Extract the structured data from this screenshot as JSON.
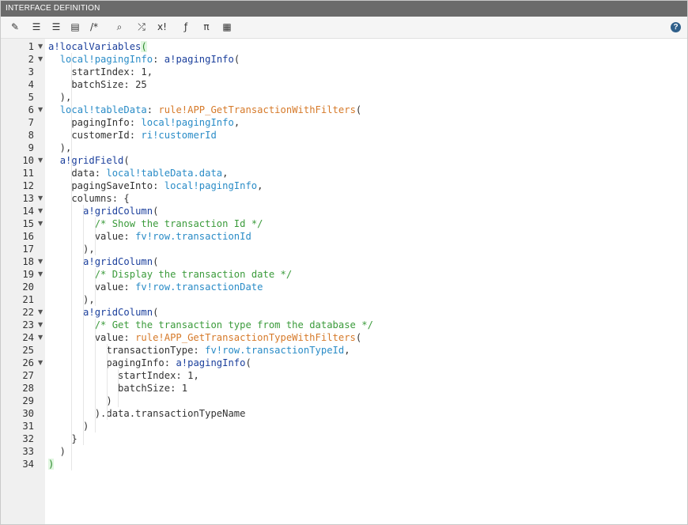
{
  "panel": {
    "title": "INTERFACE DEFINITION"
  },
  "toolbar": {
    "buttons": [
      {
        "name": "edit-icon",
        "glyph": "✎"
      },
      {
        "name": "indent-icon",
        "glyph": "☰"
      },
      {
        "name": "outdent-icon",
        "glyph": "☰"
      },
      {
        "name": "format-icon",
        "glyph": "▤"
      },
      {
        "name": "comment-icon",
        "glyph": "/*"
      },
      {
        "name": "search-icon",
        "glyph": "⌕"
      },
      {
        "name": "shuffle-icon",
        "glyph": "⤮"
      },
      {
        "name": "expression-icon",
        "glyph": "x!"
      },
      {
        "name": "function-icon",
        "glyph": "ƒ"
      },
      {
        "name": "pi-icon",
        "glyph": "π"
      },
      {
        "name": "document-icon",
        "glyph": "▦"
      }
    ],
    "help": "?"
  },
  "code_lines": [
    {
      "n": "1",
      "fold": true,
      "tokens": [
        [
          "kw",
          "a!localVariables"
        ],
        [
          "bracket",
          "("
        ]
      ]
    },
    {
      "n": "2",
      "fold": true,
      "tokens": [
        [
          "txt",
          "  "
        ],
        [
          "var",
          "local!pagingInfo"
        ],
        [
          "txt",
          ": "
        ],
        [
          "kw",
          "a!pagingInfo"
        ],
        [
          "txt",
          "("
        ]
      ]
    },
    {
      "n": "3",
      "fold": false,
      "tokens": [
        [
          "txt",
          "    startIndex: "
        ],
        [
          "lit",
          "1"
        ],
        [
          "txt",
          ","
        ]
      ]
    },
    {
      "n": "4",
      "fold": false,
      "tokens": [
        [
          "txt",
          "    batchSize: "
        ],
        [
          "lit",
          "25"
        ]
      ]
    },
    {
      "n": "5",
      "fold": false,
      "tokens": [
        [
          "txt",
          "  ),"
        ]
      ]
    },
    {
      "n": "6",
      "fold": true,
      "tokens": [
        [
          "txt",
          "  "
        ],
        [
          "var",
          "local!tableData"
        ],
        [
          "txt",
          ": "
        ],
        [
          "rule",
          "rule!APP_GetTransactionWithFilters"
        ],
        [
          "txt",
          "("
        ]
      ]
    },
    {
      "n": "7",
      "fold": false,
      "tokens": [
        [
          "txt",
          "    pagingInfo: "
        ],
        [
          "var",
          "local!pagingInfo"
        ],
        [
          "txt",
          ","
        ]
      ]
    },
    {
      "n": "8",
      "fold": false,
      "tokens": [
        [
          "txt",
          "    customerId: "
        ],
        [
          "var",
          "ri!customerId"
        ]
      ]
    },
    {
      "n": "9",
      "fold": false,
      "tokens": [
        [
          "txt",
          "  ),"
        ]
      ]
    },
    {
      "n": "10",
      "fold": true,
      "tokens": [
        [
          "txt",
          "  "
        ],
        [
          "kw",
          "a!gridField"
        ],
        [
          "txt",
          "("
        ]
      ]
    },
    {
      "n": "11",
      "fold": false,
      "tokens": [
        [
          "txt",
          "    data: "
        ],
        [
          "var",
          "local!tableData.data"
        ],
        [
          "txt",
          ","
        ]
      ]
    },
    {
      "n": "12",
      "fold": false,
      "tokens": [
        [
          "txt",
          "    pagingSaveInto: "
        ],
        [
          "var",
          "local!pagingInfo"
        ],
        [
          "txt",
          ","
        ]
      ]
    },
    {
      "n": "13",
      "fold": true,
      "tokens": [
        [
          "txt",
          "    columns: {"
        ]
      ]
    },
    {
      "n": "14",
      "fold": true,
      "tokens": [
        [
          "txt",
          "      "
        ],
        [
          "kw",
          "a!gridColumn"
        ],
        [
          "txt",
          "("
        ]
      ]
    },
    {
      "n": "15",
      "fold": true,
      "tokens": [
        [
          "txt",
          "        "
        ],
        [
          "cm",
          "/* Show the transaction Id */"
        ]
      ]
    },
    {
      "n": "16",
      "fold": false,
      "tokens": [
        [
          "txt",
          "        value: "
        ],
        [
          "var",
          "fv!row.transactionId"
        ]
      ]
    },
    {
      "n": "17",
      "fold": false,
      "tokens": [
        [
          "txt",
          "      ),"
        ]
      ]
    },
    {
      "n": "18",
      "fold": true,
      "tokens": [
        [
          "txt",
          "      "
        ],
        [
          "kw",
          "a!gridColumn"
        ],
        [
          "txt",
          "("
        ]
      ]
    },
    {
      "n": "19",
      "fold": true,
      "tokens": [
        [
          "txt",
          "        "
        ],
        [
          "cm",
          "/* Display the transaction date */"
        ]
      ]
    },
    {
      "n": "20",
      "fold": false,
      "tokens": [
        [
          "txt",
          "        value: "
        ],
        [
          "var",
          "fv!row.transactionDate"
        ]
      ]
    },
    {
      "n": "21",
      "fold": false,
      "tokens": [
        [
          "txt",
          "      ),"
        ]
      ]
    },
    {
      "n": "22",
      "fold": true,
      "tokens": [
        [
          "txt",
          "      "
        ],
        [
          "kw",
          "a!gridColumn"
        ],
        [
          "txt",
          "("
        ]
      ]
    },
    {
      "n": "23",
      "fold": true,
      "tokens": [
        [
          "txt",
          "        "
        ],
        [
          "cm",
          "/* Get the transaction type from the database */"
        ]
      ]
    },
    {
      "n": "24",
      "fold": true,
      "tokens": [
        [
          "txt",
          "        value: "
        ],
        [
          "rule",
          "rule!APP_GetTransactionTypeWithFilters"
        ],
        [
          "txt",
          "("
        ]
      ]
    },
    {
      "n": "25",
      "fold": false,
      "tokens": [
        [
          "txt",
          "          transactionType: "
        ],
        [
          "var",
          "fv!row.transactionTypeId"
        ],
        [
          "txt",
          ","
        ]
      ]
    },
    {
      "n": "26",
      "fold": true,
      "tokens": [
        [
          "txt",
          "          pagingInfo: "
        ],
        [
          "kw",
          "a!pagingInfo"
        ],
        [
          "txt",
          "("
        ]
      ]
    },
    {
      "n": "27",
      "fold": false,
      "tokens": [
        [
          "txt",
          "            startIndex: "
        ],
        [
          "lit",
          "1"
        ],
        [
          "txt",
          ","
        ]
      ]
    },
    {
      "n": "28",
      "fold": false,
      "tokens": [
        [
          "txt",
          "            batchSize: "
        ],
        [
          "lit",
          "1"
        ]
      ]
    },
    {
      "n": "29",
      "fold": false,
      "tokens": [
        [
          "txt",
          "          )"
        ]
      ]
    },
    {
      "n": "30",
      "fold": false,
      "tokens": [
        [
          "txt",
          "        ).data.transactionTypeName"
        ]
      ]
    },
    {
      "n": "31",
      "fold": false,
      "tokens": [
        [
          "txt",
          "      )"
        ]
      ]
    },
    {
      "n": "32",
      "fold": false,
      "tokens": [
        [
          "txt",
          "    }"
        ]
      ]
    },
    {
      "n": "33",
      "fold": false,
      "tokens": [
        [
          "txt",
          "  )"
        ]
      ]
    },
    {
      "n": "34",
      "fold": false,
      "tokens": [
        [
          "bracket",
          ")"
        ]
      ]
    }
  ]
}
